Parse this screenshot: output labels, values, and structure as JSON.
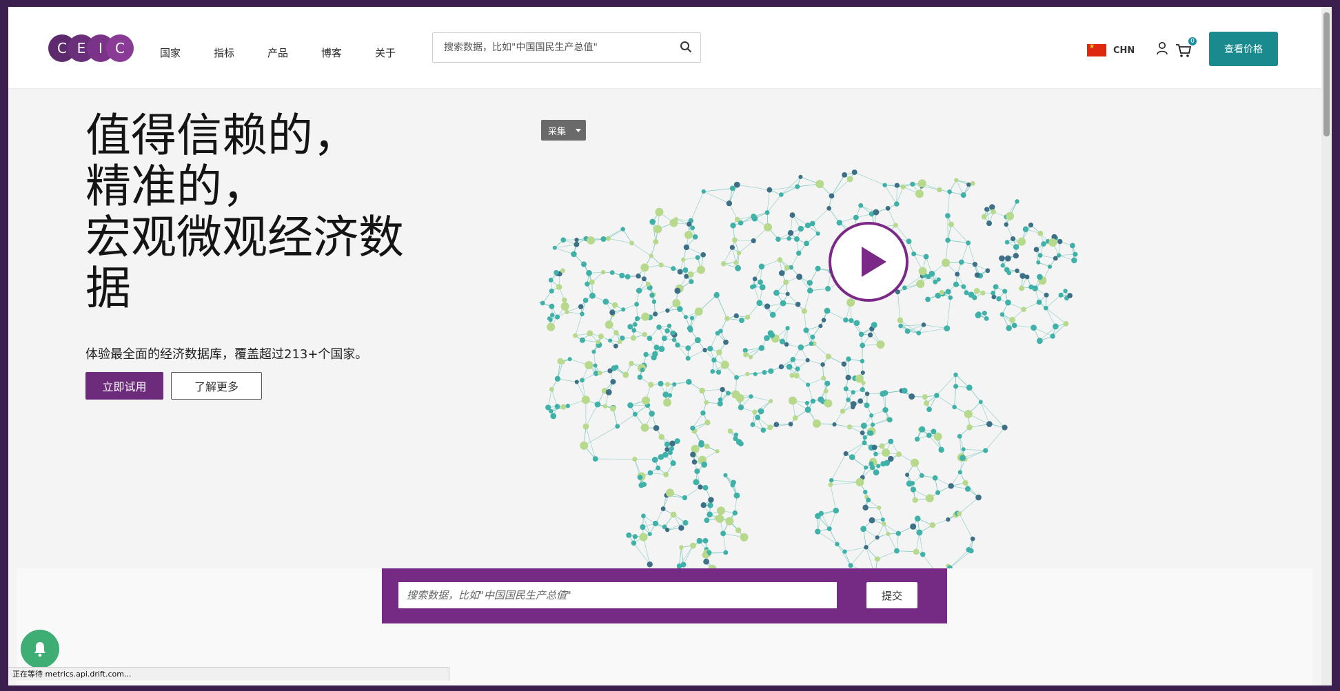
{
  "header": {
    "logo_letters": [
      "C",
      "E",
      "I",
      "C"
    ],
    "nav": [
      {
        "label": "国家"
      },
      {
        "label": "指标"
      },
      {
        "label": "产品"
      },
      {
        "label": "博客"
      },
      {
        "label": "关于"
      }
    ],
    "search_placeholder": "搜索数据，比如\"中国国民生产总值\"",
    "country_code": "CHN",
    "cart_count": "0",
    "price_button": "查看价格"
  },
  "hero": {
    "title_lines": [
      "值得信赖的，",
      "精准的，",
      "宏观微观经济数",
      "据"
    ],
    "subtitle": "体验最全面的经济数据库，覆盖超过213+个国家。",
    "try_button": "立即试用",
    "more_button": "了解更多"
  },
  "collect_button": "采集",
  "bottom_search": {
    "placeholder": "搜索数据，比如\"中国国民生产总值\"",
    "submit": "提交"
  },
  "status_text": "正在等待 metrics.api.drift.com...",
  "colors": {
    "brand_purple": "#752a83",
    "teal": "#1a8a8f",
    "node_teal": "#3fb1a8",
    "node_light": "#b7d98b",
    "node_dark": "#3d6f86",
    "notify_green": "#3fae75"
  },
  "icons": [
    "search-icon",
    "user-icon",
    "cart-icon",
    "play-icon",
    "bell-icon",
    "flag-icon"
  ]
}
